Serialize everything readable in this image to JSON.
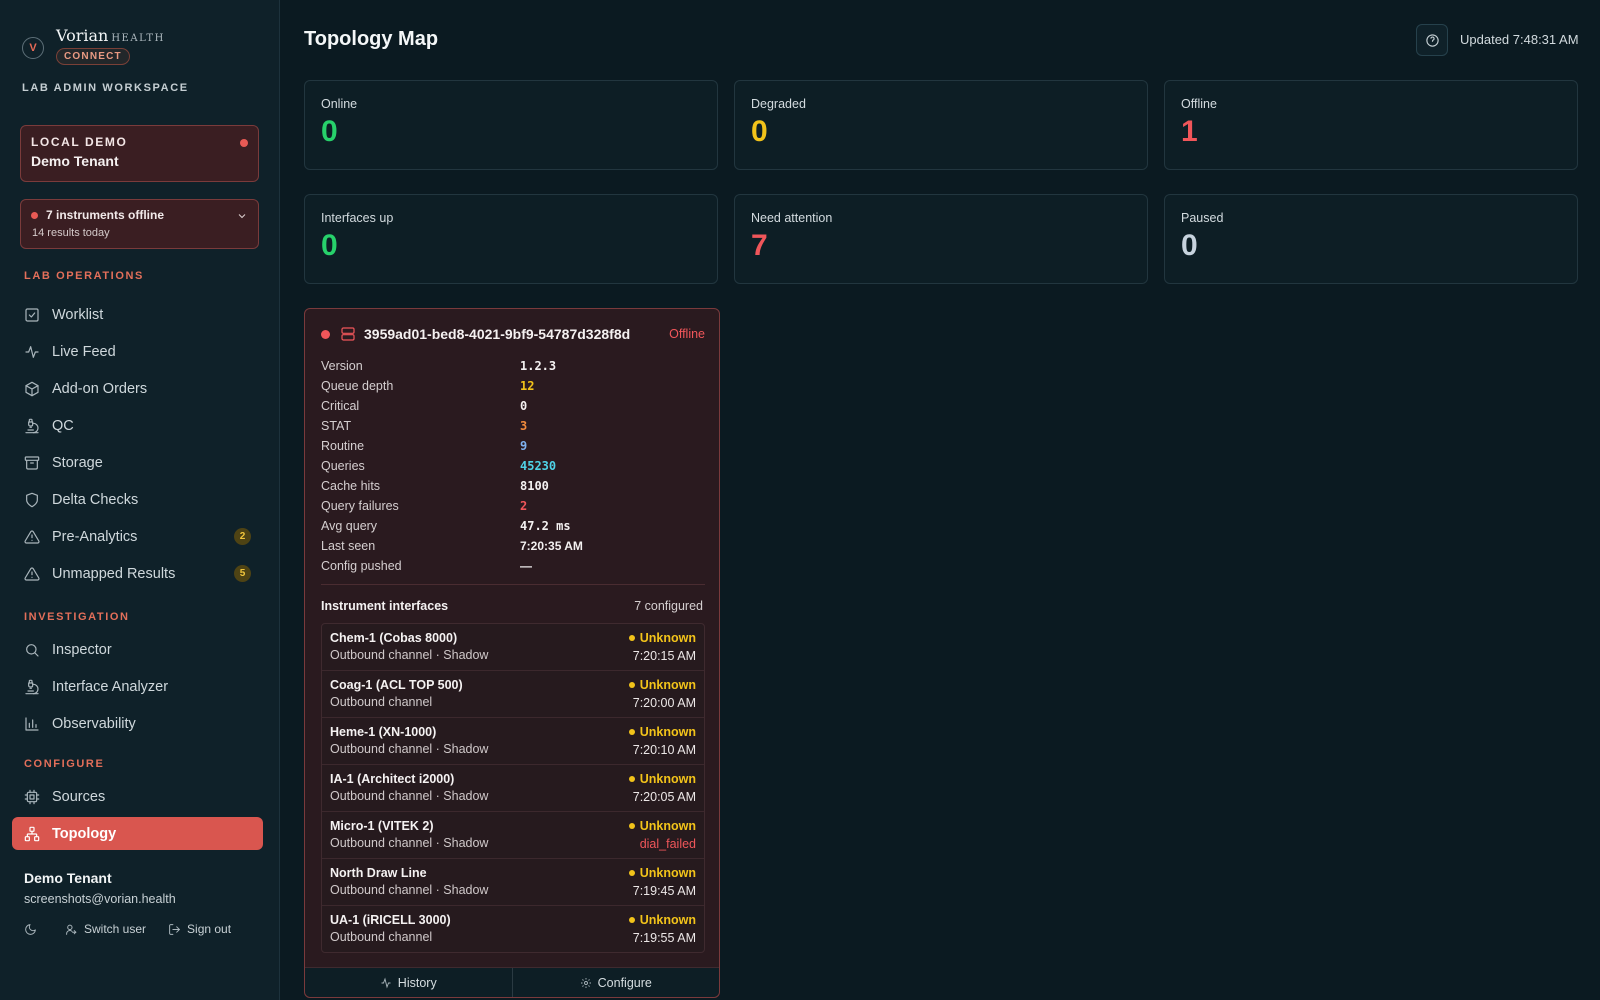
{
  "brand": {
    "name": "Vorian",
    "suffix": "HEALTH",
    "pill": "CONNECT",
    "workspace": "LAB ADMIN WORKSPACE"
  },
  "tenant_box": {
    "tag": "LOCAL DEMO",
    "name": "Demo Tenant"
  },
  "alert_box": {
    "title": "7 instruments offline",
    "subtitle": "14 results today"
  },
  "sidebar": {
    "sections": [
      {
        "label": "LAB OPERATIONS"
      },
      {
        "label": "INVESTIGATION"
      },
      {
        "label": "CONFIGURE"
      }
    ],
    "items": [
      {
        "label": "Worklist",
        "icon": "checkbox-icon"
      },
      {
        "label": "Live Feed",
        "icon": "activity-icon"
      },
      {
        "label": "Add-on Orders",
        "icon": "package-icon"
      },
      {
        "label": "QC",
        "icon": "microscope-icon"
      },
      {
        "label": "Storage",
        "icon": "archive-icon"
      },
      {
        "label": "Delta Checks",
        "icon": "shield-icon"
      },
      {
        "label": "Pre-Analytics",
        "icon": "warning-icon",
        "badge": "2"
      },
      {
        "label": "Unmapped Results",
        "icon": "warning-icon",
        "badge": "5"
      },
      {
        "label": "Inspector",
        "icon": "search-icon"
      },
      {
        "label": "Interface Analyzer",
        "icon": "microscope-icon"
      },
      {
        "label": "Observability",
        "icon": "bar-chart-icon"
      },
      {
        "label": "Sources",
        "icon": "cpu-icon"
      },
      {
        "label": "Topology",
        "icon": "network-icon",
        "active": true
      }
    ]
  },
  "user": {
    "name": "Demo Tenant",
    "email": "screenshots@vorian.health",
    "switch_label": "Switch user",
    "signout_label": "Sign out"
  },
  "header": {
    "title": "Topology Map",
    "updated": "Updated 7:48:31 AM"
  },
  "stats": [
    {
      "label": "Online",
      "value": "0",
      "color": "#27d16b"
    },
    {
      "label": "Degraded",
      "value": "0",
      "color": "#f2c31a"
    },
    {
      "label": "Offline",
      "value": "1",
      "color": "#f0565a"
    },
    {
      "label": "Interfaces up",
      "value": "0",
      "color": "#27d16b"
    },
    {
      "label": "Need attention",
      "value": "7",
      "color": "#f0565a"
    },
    {
      "label": "Paused",
      "value": "0",
      "color": "#c7d3de"
    }
  ],
  "node": {
    "id": "3959ad01-bed8-4021-9bf9-54787d328f8d",
    "status": "Offline",
    "details": [
      {
        "key": "Version",
        "value": "1.2.3"
      },
      {
        "key": "Queue depth",
        "value": "12"
      },
      {
        "key": "Critical",
        "value": "0"
      },
      {
        "key": "STAT",
        "value": "3"
      },
      {
        "key": "Routine",
        "value": "9"
      },
      {
        "key": "Queries",
        "value": "45230"
      },
      {
        "key": "Cache hits",
        "value": "8100"
      },
      {
        "key": "Query failures",
        "value": "2"
      },
      {
        "key": "Avg query",
        "value": "47.2 ms"
      },
      {
        "key": "Last seen",
        "value": "7:20:35 AM"
      },
      {
        "key": "Config pushed",
        "value": "—"
      }
    ],
    "interfaces_title": "Instrument interfaces",
    "interfaces_count": "7 configured",
    "interfaces": [
      {
        "name": "Chem-1 (Cobas 8000)",
        "sub": "Outbound channel · Shadow",
        "status": "Unknown",
        "time": "7:20:15 AM"
      },
      {
        "name": "Coag-1 (ACL TOP 500)",
        "sub": "Outbound channel",
        "status": "Unknown",
        "time": "7:20:00 AM"
      },
      {
        "name": "Heme-1 (XN-1000)",
        "sub": "Outbound channel · Shadow",
        "status": "Unknown",
        "time": "7:20:10 AM"
      },
      {
        "name": "IA-1 (Architect i2000)",
        "sub": "Outbound channel · Shadow",
        "status": "Unknown",
        "time": "7:20:05 AM"
      },
      {
        "name": "Micro-1 (VITEK 2)",
        "sub": "Outbound channel · Shadow",
        "status": "Unknown",
        "time": "dial_failed"
      },
      {
        "name": "North Draw Line",
        "sub": "Outbound channel · Shadow",
        "status": "Unknown",
        "time": "7:19:45 AM"
      },
      {
        "name": "UA-1 (iRICELL 3000)",
        "sub": "Outbound channel",
        "status": "Unknown",
        "time": "7:19:55 AM"
      }
    ],
    "history_label": "History",
    "configure_label": "Configure"
  }
}
